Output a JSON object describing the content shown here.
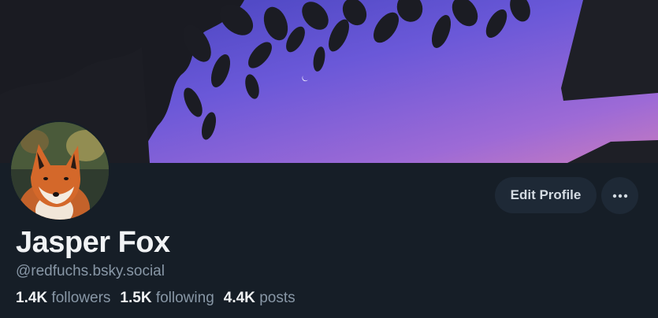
{
  "profile": {
    "display_name": "Jasper Fox",
    "handle": "@redfuchs.bsky.social"
  },
  "stats": {
    "followers_count": "1.4K",
    "followers_label": "followers",
    "following_count": "1.5K",
    "following_label": "following",
    "posts_count": "4.4K",
    "posts_label": "posts"
  },
  "actions": {
    "edit_label": "Edit Profile",
    "more_icon": "ellipsis-icon"
  },
  "colors": {
    "page_background": "#161e27",
    "button_background": "#1e2936",
    "secondary_text": "#8897a6",
    "sky_top": "#4a4fd0",
    "sky_bottom": "#c173c6"
  }
}
